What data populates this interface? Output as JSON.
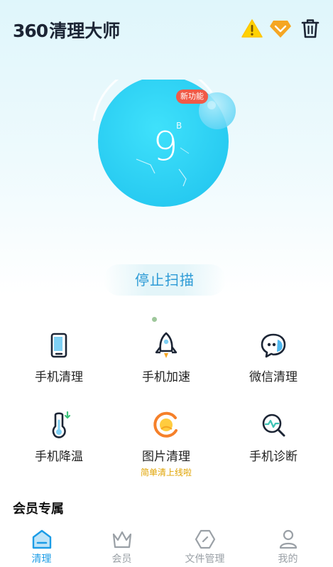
{
  "header": {
    "logo_number": "360",
    "logo_text": "清理大师",
    "icons": [
      "warning-icon",
      "vip-diamond-icon",
      "trash-icon"
    ]
  },
  "scan": {
    "value": "9",
    "unit": "B",
    "stop_label": "停止扫描"
  },
  "features": [
    {
      "label": "手机清理",
      "icon": "phone-clean-icon",
      "sub": ""
    },
    {
      "label": "手机加速",
      "icon": "rocket-icon",
      "sub": ""
    },
    {
      "label": "微信清理",
      "icon": "wechat-clean-icon",
      "sub": ""
    },
    {
      "label": "手机降温",
      "icon": "thermometer-icon",
      "sub": ""
    },
    {
      "label": "图片清理",
      "icon": "image-clean-icon",
      "sub": "简单清上线啦",
      "badge": "新功能"
    },
    {
      "label": "手机诊断",
      "icon": "diagnose-icon",
      "sub": ""
    }
  ],
  "member": {
    "title": "会员专属"
  },
  "nav": {
    "active": "清理",
    "items": [
      {
        "label": "清理",
        "icon": "clean-home-icon"
      },
      {
        "label": "会员",
        "icon": "crown-icon"
      },
      {
        "label": "文件管理",
        "icon": "file-manage-icon"
      },
      {
        "label": "我的",
        "icon": "profile-icon"
      }
    ]
  },
  "colors": {
    "accent": "#1b9ce6",
    "ball": "#33d2f5",
    "warning": "#ffd200",
    "vip": "#f5a623",
    "badge": "#f05a47",
    "sub_text": "#e0a300"
  }
}
